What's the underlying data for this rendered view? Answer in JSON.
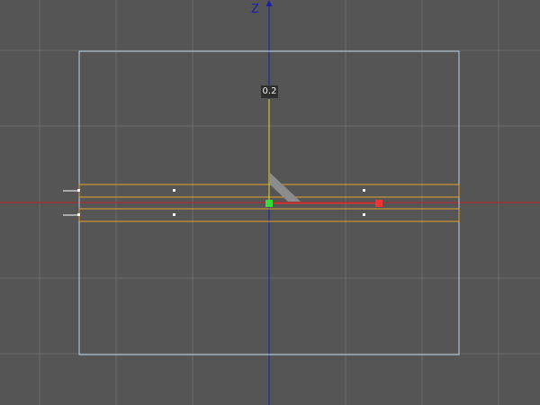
{
  "viewport": {
    "background_color": "#555555",
    "grid_color": "#6b6b6b",
    "vertical_axis": {
      "label": "Z",
      "color": "#1d1da8"
    },
    "horizontal_axis": {
      "color": "#c02525"
    },
    "frame_color": "#b8d4ea",
    "selection_color": "#e2a22a",
    "gizmo": {
      "value_label": "0.2",
      "axis_line_color": "#e8d23a",
      "center_handle_color": "#35e035",
      "x_handle_color": "#ee3434",
      "rotation_arc_color": "#8c8c8c"
    }
  }
}
